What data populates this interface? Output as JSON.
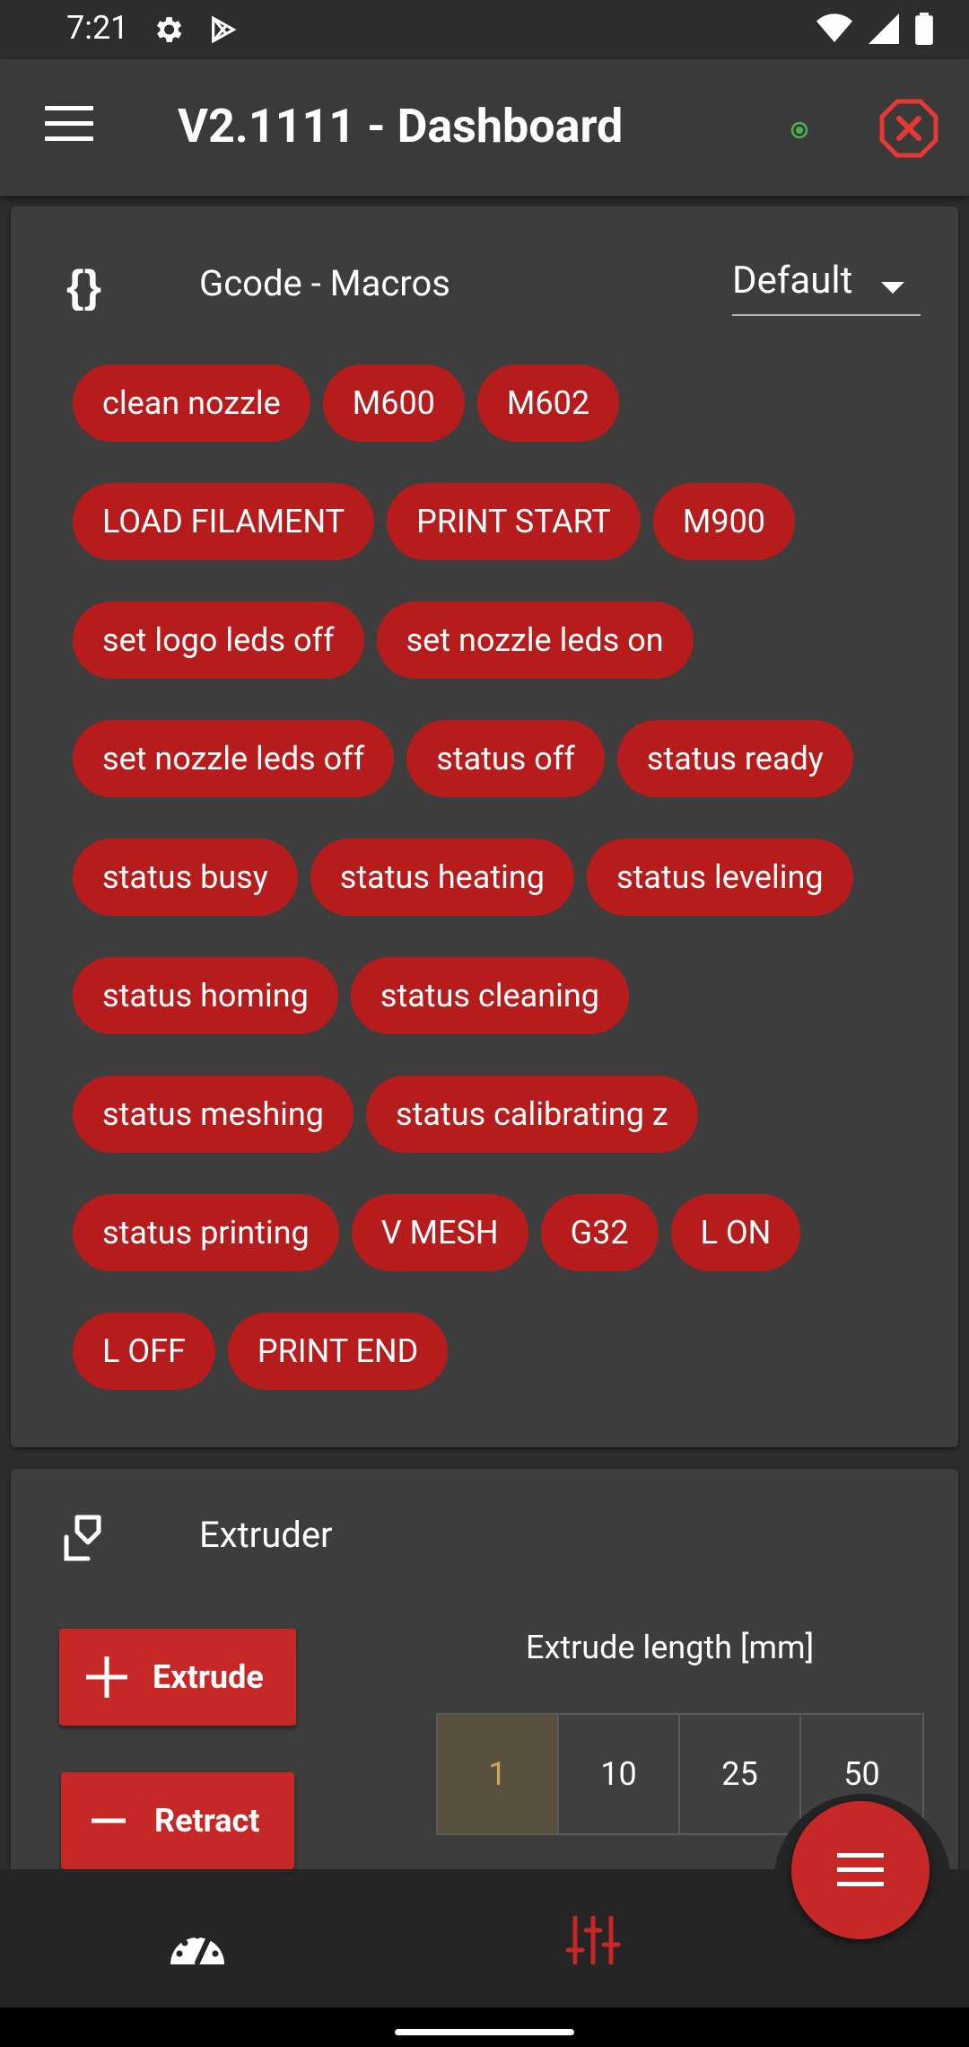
{
  "status_bar": {
    "time": "7:21",
    "icons": [
      "gear-icon",
      "play-store-icon",
      "wifi-icon",
      "cellular-signal-icon",
      "battery-icon"
    ]
  },
  "app_bar": {
    "title": "V2.1111 - Dashboard",
    "menu_icon": "hamburger-menu-icon",
    "status_indicator": "online",
    "stop_icon": "emergency-stop-icon"
  },
  "macros_card": {
    "title": "Gcode - Macros",
    "icon": "curly-braces-icon",
    "group_select": {
      "value": "Default"
    },
    "chip_rows": [
      [
        "clean nozzle",
        "M600",
        "M602"
      ],
      [
        "LOAD FILAMENT",
        "PRINT START",
        "M900"
      ],
      [
        "set logo leds off",
        "set nozzle leds on"
      ],
      [
        "set nozzle leds off",
        "status off",
        "status ready"
      ],
      [
        "status busy",
        "status heating",
        "status leveling"
      ],
      [
        "status homing",
        "status cleaning"
      ],
      [
        "status meshing",
        "status calibrating z"
      ],
      [
        "status printing",
        "V MESH",
        "G32",
        "L ON"
      ],
      [
        "L OFF",
        "PRINT END"
      ]
    ]
  },
  "extruder_card": {
    "title": "Extruder",
    "icon": "extruder-icon",
    "extrude_label": "Extrude",
    "retract_label": "Retract",
    "length_label": "Extrude length [mm]",
    "length_options": [
      "1",
      "10",
      "25",
      "50"
    ],
    "selected_length": "1"
  },
  "bottom_nav": {
    "items": [
      "dashboard-icon",
      "settings-sliders-icon"
    ],
    "fab_icon": "menu-icon"
  },
  "colors": {
    "accent": "#c62828",
    "chip": "#b71c1c",
    "card_bg": "#3d3d3d",
    "app_bar_bg": "#3a3a3a",
    "online": "#4caf50",
    "selected_length_text": "#d2a55a"
  }
}
